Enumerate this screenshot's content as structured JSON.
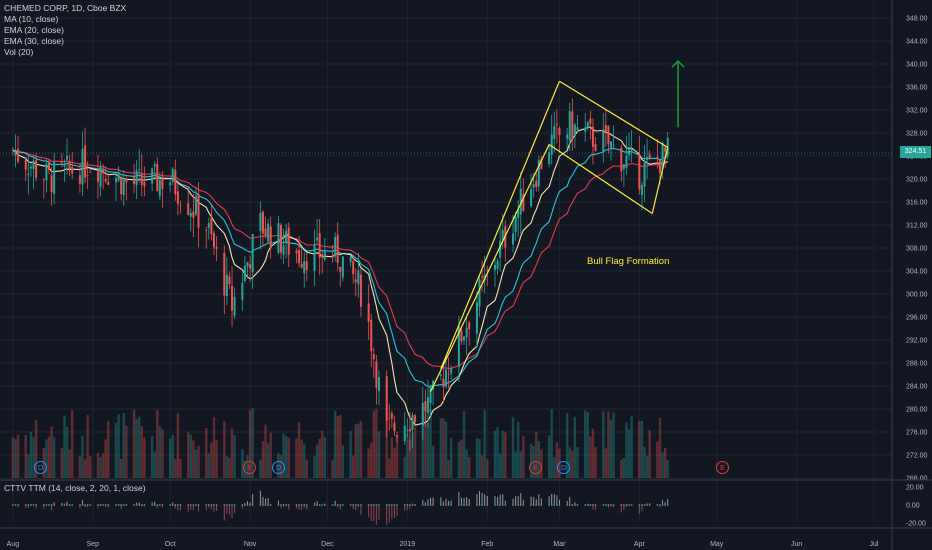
{
  "legend": {
    "title": "CHEMED CORP, 1D, Cboe BZX",
    "ma10": "MA (10, close)",
    "ema20": "EMA (20, close)",
    "ema30": "EMA (30, close)",
    "vol": "Vol (20)"
  },
  "oscillator_label": "CTTV TTM (14, close, 2, 20, 1, close)",
  "annotation": "Bull Flag Formation",
  "current_price": "324.51",
  "events": [
    "D",
    "E",
    "D",
    "E",
    "E",
    "D",
    "E"
  ],
  "colors": {
    "background": "#131722",
    "up": "#26a69a",
    "down": "#ef5350",
    "ma10": "#f4e4b0",
    "ema20": "#26c6da",
    "ema30": "#e53950",
    "flag": "#ffeb3b",
    "arrow": "#1b9e3e"
  },
  "chart_data": [
    {
      "type": "candlestick",
      "title": "CHEMED CORP, 1D, Cboe BZX",
      "x_ticks": [
        "Aug",
        "Sep",
        "Oct",
        "Nov",
        "Dec",
        "2019",
        "Feb",
        "Mar",
        "Apr",
        "May",
        "Jun",
        "Jul"
      ],
      "y_ticks": [
        268,
        272,
        276,
        280,
        284,
        288,
        292,
        296,
        300,
        304,
        308,
        312,
        316,
        320,
        324,
        328,
        332,
        336,
        340,
        344,
        348
      ],
      "ylim": [
        267,
        350
      ],
      "grid": true,
      "series": [
        {
          "name": "MA (10, close)"
        },
        {
          "name": "EMA (20, close)"
        },
        {
          "name": "EMA (30, close)"
        },
        {
          "name": "Vol (20)"
        }
      ],
      "anchors": [
        {
          "date": "2018-08-01",
          "close": 325
        },
        {
          "date": "2018-08-15",
          "close": 320
        },
        {
          "date": "2018-09-01",
          "close": 323
        },
        {
          "date": "2018-09-15",
          "close": 319
        },
        {
          "date": "2018-10-01",
          "close": 320
        },
        {
          "date": "2018-10-15",
          "close": 312
        },
        {
          "date": "2018-10-25",
          "close": 298
        },
        {
          "date": "2018-11-05",
          "close": 312
        },
        {
          "date": "2018-11-20",
          "close": 307
        },
        {
          "date": "2018-12-05",
          "close": 307
        },
        {
          "date": "2018-12-15",
          "close": 300
        },
        {
          "date": "2018-12-24",
          "close": 276
        },
        {
          "date": "2019-01-10",
          "close": 281
        },
        {
          "date": "2019-01-25",
          "close": 296
        },
        {
          "date": "2019-02-10",
          "close": 312
        },
        {
          "date": "2019-02-25",
          "close": 326
        },
        {
          "date": "2019-03-05",
          "close": 329
        },
        {
          "date": "2019-03-20",
          "close": 326
        },
        {
          "date": "2019-04-01",
          "close": 321
        },
        {
          "date": "2019-04-12",
          "close": 324.5
        }
      ]
    },
    {
      "type": "bar",
      "title": "CTTV TTM (14, close, 2, 20, 1, close)",
      "y_ticks": [
        20,
        0,
        -20
      ],
      "ylim": [
        -25,
        25
      ]
    }
  ]
}
